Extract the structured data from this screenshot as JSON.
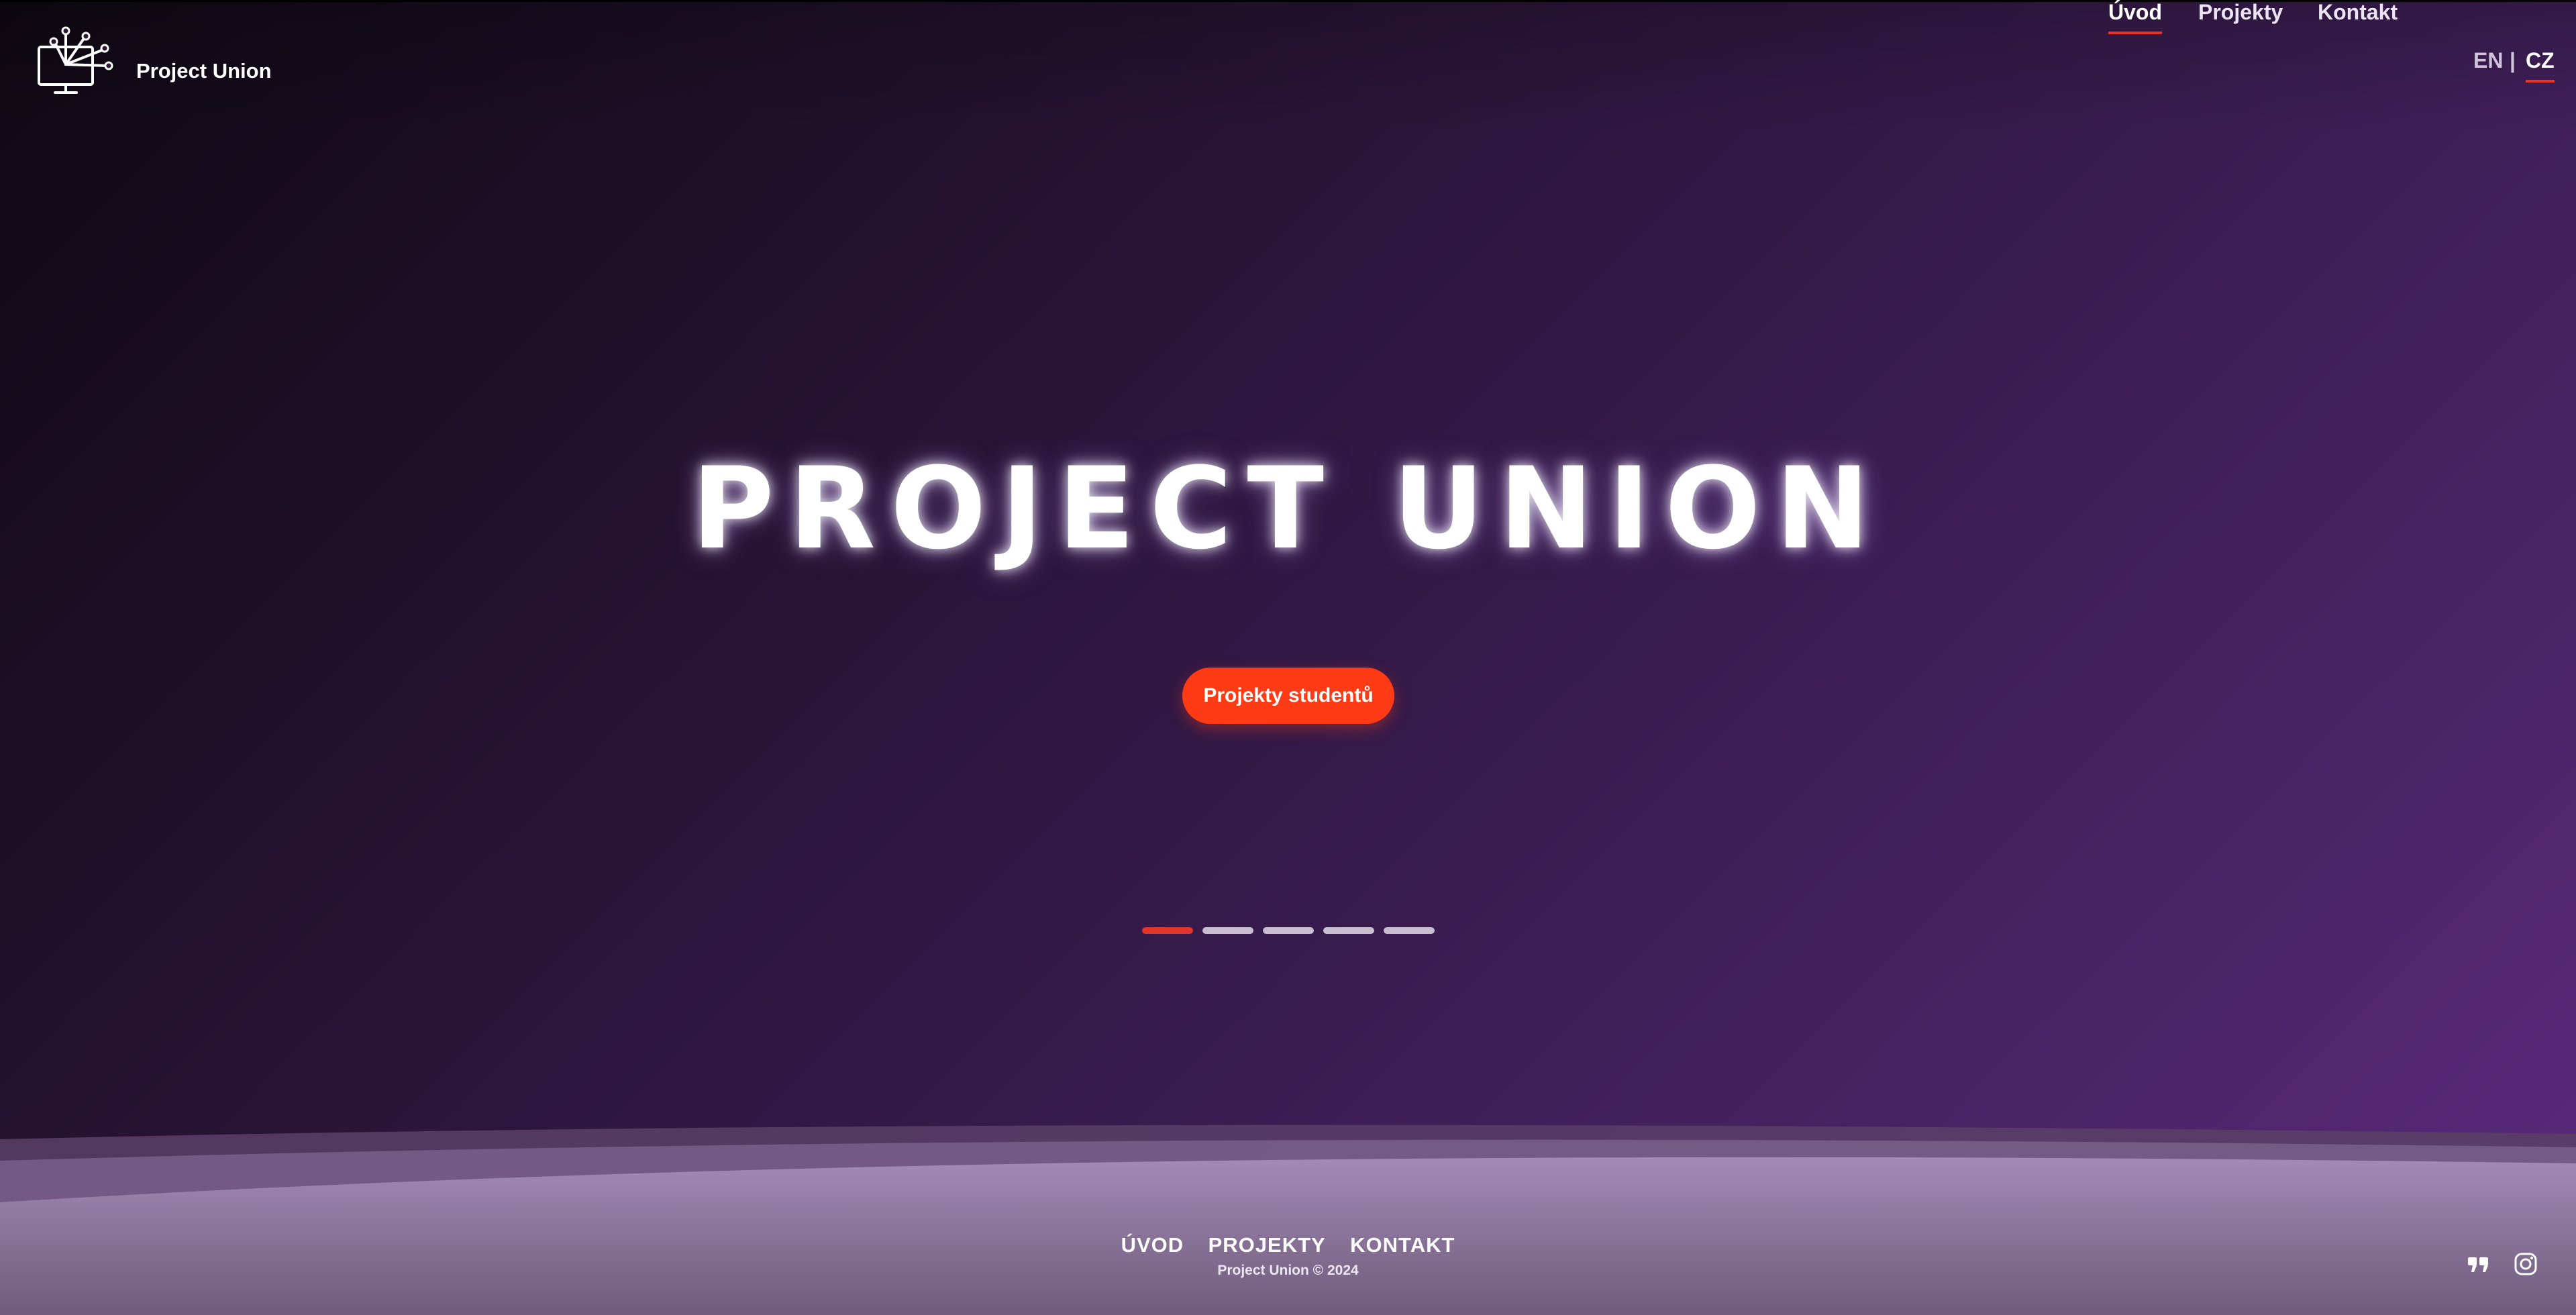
{
  "header": {
    "brand": "Project Union",
    "nav": [
      {
        "label": "Úvod",
        "active": true
      },
      {
        "label": "Projekty",
        "active": false
      },
      {
        "label": "Kontakt",
        "active": false
      }
    ],
    "lang": {
      "en": "EN",
      "sep": "|",
      "cz": "CZ",
      "active": "CZ"
    }
  },
  "hero": {
    "title": "PROJECT UNION",
    "cta_label": "Projekty studentů",
    "slides_total": 5,
    "slide_active": 1
  },
  "footer": {
    "links": [
      "ÚVOD",
      "PROJEKTY",
      "KONTAKT"
    ],
    "copyright": "Project Union © 2024",
    "social_icons": [
      "quote-icon",
      "instagram-icon"
    ]
  },
  "colors": {
    "accent": "#e8332a",
    "cta": "#ff3b16",
    "bg_dark": "#0f0812",
    "bg_purple": "#5a2a7c"
  }
}
